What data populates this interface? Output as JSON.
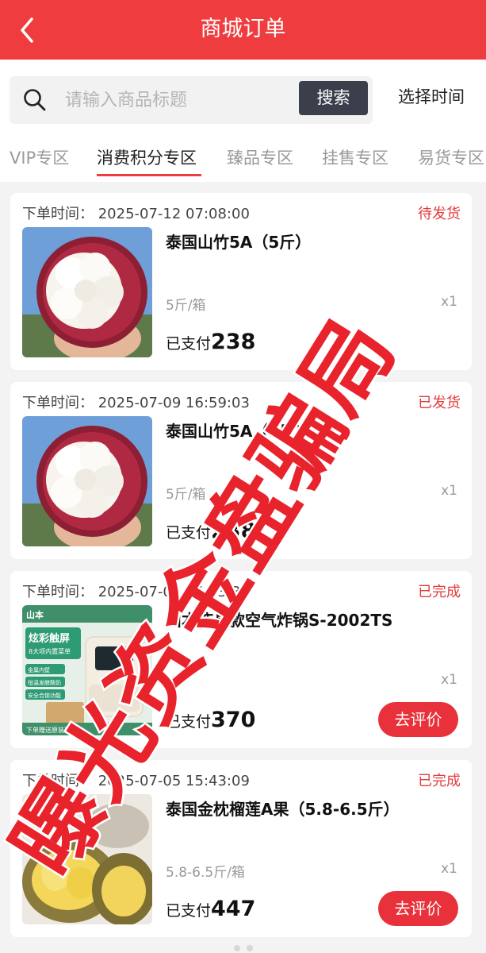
{
  "header": {
    "title": "商城订单"
  },
  "search": {
    "placeholder": "请输入商品标题",
    "button": "搜索",
    "time_button": "选择时间"
  },
  "tabs": [
    {
      "label": "VIP专区"
    },
    {
      "label": "消费积分专区"
    },
    {
      "label": "臻品专区"
    },
    {
      "label": "挂售专区"
    },
    {
      "label": "易货专区"
    }
  ],
  "orders": [
    {
      "time": "下单时间：  2025-07-12 07:08:00",
      "status": "待发货",
      "name": "泰国山竹5A（5斤）",
      "spec": "5斤/箱",
      "qty": "x1",
      "paid_label": "已支付",
      "amount": "238",
      "image": "mangosteen"
    },
    {
      "time": "下单时间：  2025-07-09 16:59:03",
      "status": "已发货",
      "name": "泰国山竹5A（5斤）",
      "spec": "5斤/箱",
      "qty": "x1",
      "paid_label": "已支付",
      "amount": "238",
      "image": "mangosteen"
    },
    {
      "time": "下单时间：  2025-07-05 15:43:32",
      "status": "已完成",
      "name": "山本液晶款空气炸锅S-2002TS",
      "spec": "",
      "qty": "x1",
      "paid_label": "已支付",
      "amount": "370",
      "review": "去评价",
      "image": "air-fryer",
      "image_text": {
        "brand": "山本",
        "headline": "炫彩触屏",
        "sub": "8大项内置菜单",
        "features": [
          "金属内壁",
          "恒温发酵酸奶",
          "安全合锁功能"
        ],
        "bottom": "下单赠送原装碗"
      }
    },
    {
      "time": "下单时间：  2025-07-05 15:43:09",
      "status": "已完成",
      "name": "泰国金枕榴莲A果（5.8-6.5斤）",
      "spec": "5.8-6.5斤/箱",
      "qty": "x1",
      "paid_label": "已支付",
      "amount": "447",
      "review": "去评价",
      "image": "durian"
    }
  ],
  "watermark": {
    "text": "曝光资金盘骗局",
    "color": "#e8232c"
  },
  "colors": {
    "brand": "#ef3c3f",
    "status": "#e23c3c",
    "search_button": "#3a3f4b"
  }
}
